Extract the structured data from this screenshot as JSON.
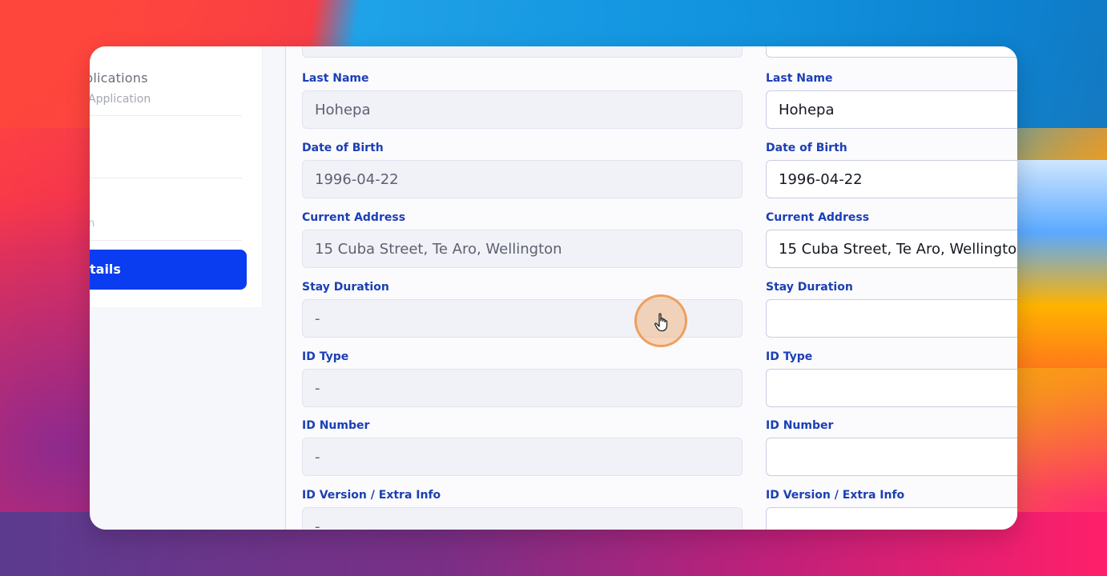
{
  "sidebar": {
    "title": "plications",
    "subtitle": "Application",
    "small_text": "n",
    "active_item": "tails"
  },
  "left_column": {
    "fields": [
      {
        "label": "Last Name",
        "value": "Hohepa"
      },
      {
        "label": "Date of Birth",
        "value": "1996-04-22"
      },
      {
        "label": "Current Address",
        "value": "15 Cuba Street, Te Aro, Wellington"
      },
      {
        "label": "Stay Duration",
        "value": "-"
      },
      {
        "label": "ID Type",
        "value": "-"
      },
      {
        "label": "ID Number",
        "value": "-"
      },
      {
        "label": "ID Version / Extra Info",
        "value": "-"
      }
    ]
  },
  "right_column": {
    "fields": [
      {
        "label": "Last Name",
        "value": "Hohepa"
      },
      {
        "label": "Date of Birth",
        "value": "1996-04-22"
      },
      {
        "label": "Current Address",
        "value": "15 Cuba Street, Te Aro, Wellingto"
      },
      {
        "label": "Stay Duration",
        "value": ""
      },
      {
        "label": "ID Type",
        "value": ""
      },
      {
        "label": "ID Number",
        "value": ""
      },
      {
        "label": "ID Version / Extra Info",
        "value": ""
      }
    ]
  },
  "colors": {
    "label": "#1b3fb5",
    "active_nav": "#0a3cf0",
    "cursor_highlight": "#ec9650"
  },
  "icons": {
    "cursor": "hand-pointer-icon"
  }
}
